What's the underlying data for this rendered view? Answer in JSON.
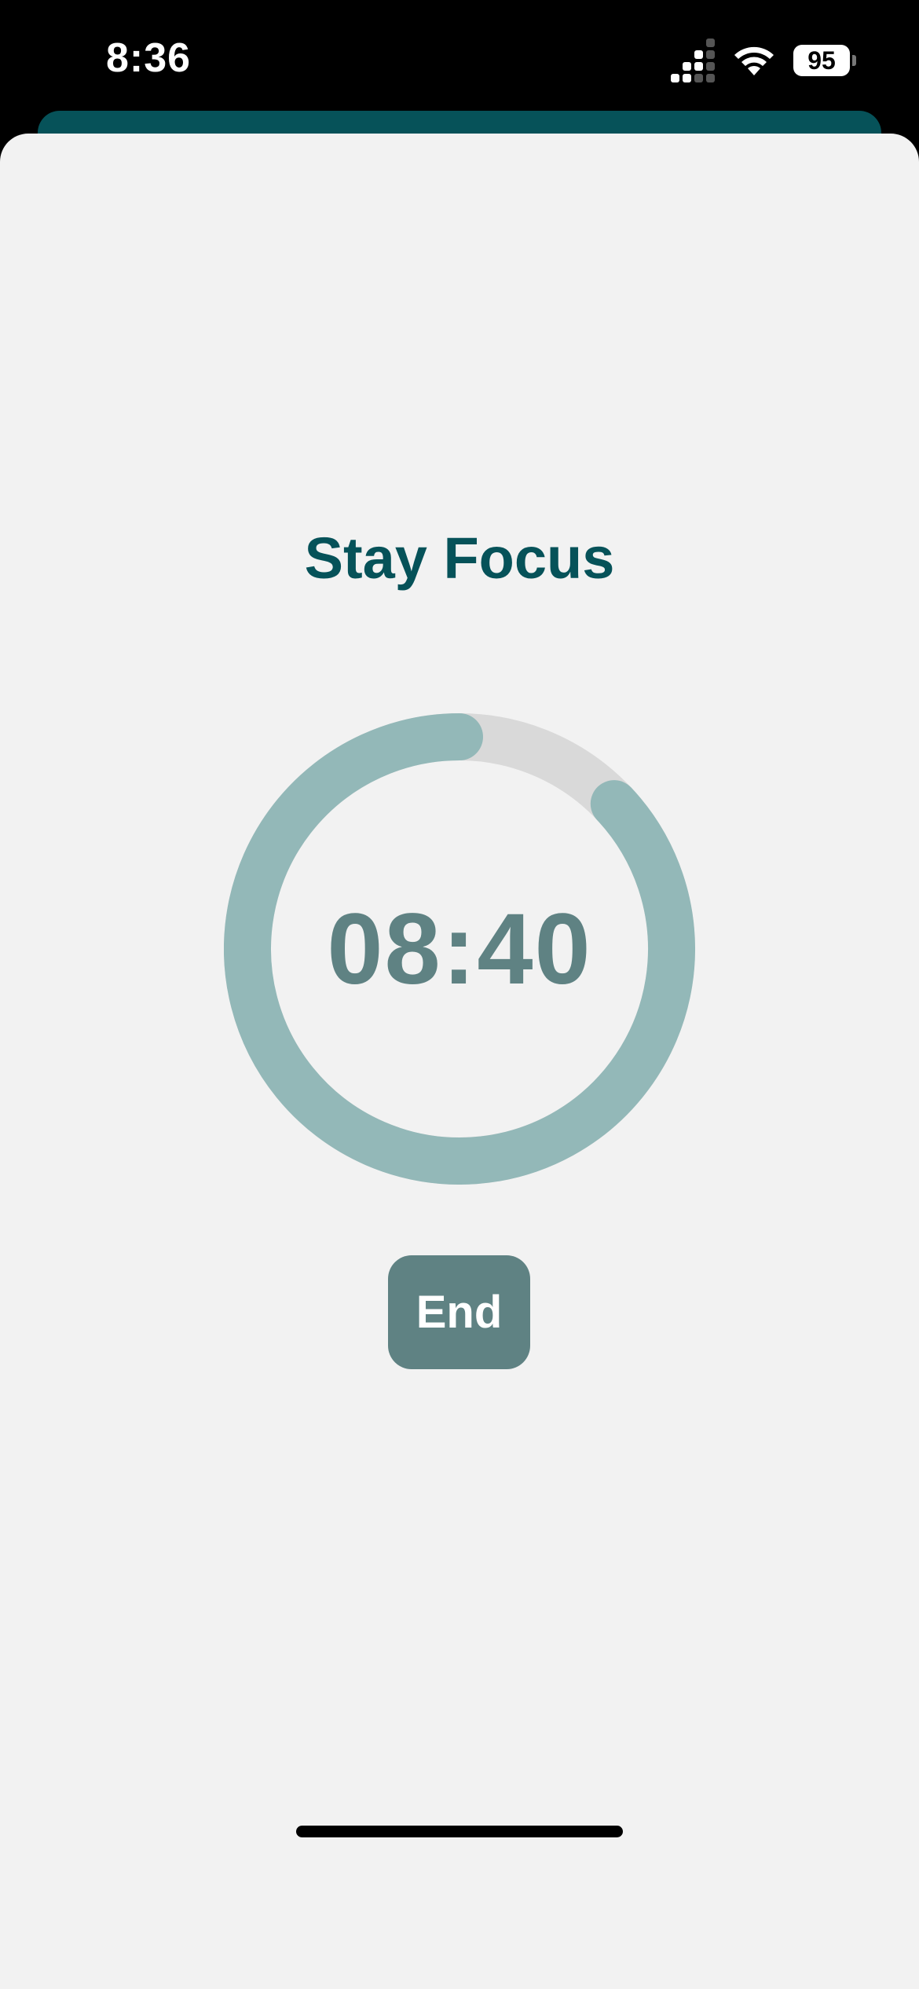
{
  "status_bar": {
    "time": "8:36",
    "battery": "95",
    "icons": [
      "cellular-signal-icon",
      "wifi-icon",
      "battery-icon"
    ]
  },
  "focus": {
    "title": "Stay Focus",
    "timer": "08:40",
    "progress": 0.87,
    "end_label": "End"
  },
  "colors": {
    "background": "#f2f2f2",
    "title": "#065259",
    "ring_progress": "#93b8b8",
    "ring_track": "#d9d9d9",
    "timer_text": "#5f8283",
    "button": "#5f8283",
    "button_text": "#ffffff"
  }
}
